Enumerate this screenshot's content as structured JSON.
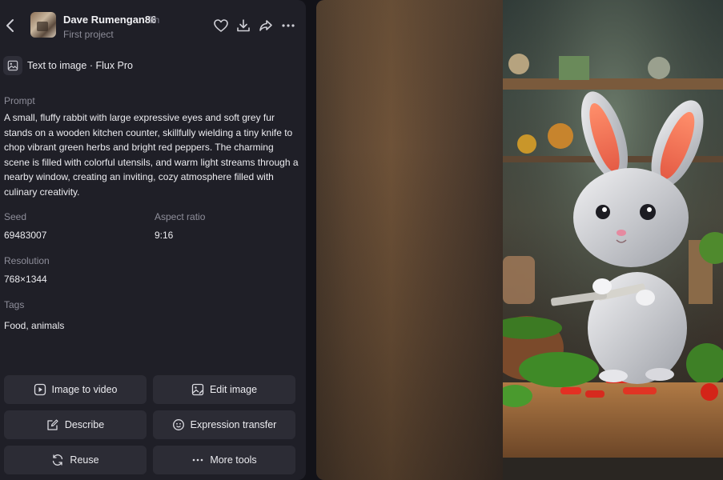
{
  "header": {
    "username": "Dave Rumengan86",
    "time": "5h",
    "project": "First project",
    "icons": [
      "back-arrow-icon",
      "heart-icon",
      "download-icon",
      "share-icon",
      "more-icon"
    ]
  },
  "model": {
    "label": "Text to image · Flux Pro",
    "icon": "image-icon"
  },
  "details": {
    "prompt_label": "Prompt",
    "prompt": "A small, fluffy rabbit with large expressive eyes and soft grey fur stands on a wooden kitchen counter, skillfully wielding a tiny knife to chop vibrant green herbs and bright red peppers. The charming scene is filled with colorful utensils, and warm light streams through a nearby window, creating an inviting, cozy atmosphere filled with culinary creativity.",
    "seed_label": "Seed",
    "seed": "69483007",
    "aspect_label": "Aspect ratio",
    "aspect": "9:16",
    "resolution_label": "Resolution",
    "resolution": "768×1344",
    "tags_label": "Tags",
    "tags": "Food, animals"
  },
  "actions": {
    "image_to_video": "Image to video",
    "edit_image": "Edit image",
    "describe": "Describe",
    "expression_transfer": "Expression transfer",
    "reuse": "Reuse",
    "more_tools": "More tools"
  },
  "colors": {
    "panel_bg": "#1f1f27",
    "button_bg": "#2c2c35",
    "page_bg": "#121218"
  }
}
